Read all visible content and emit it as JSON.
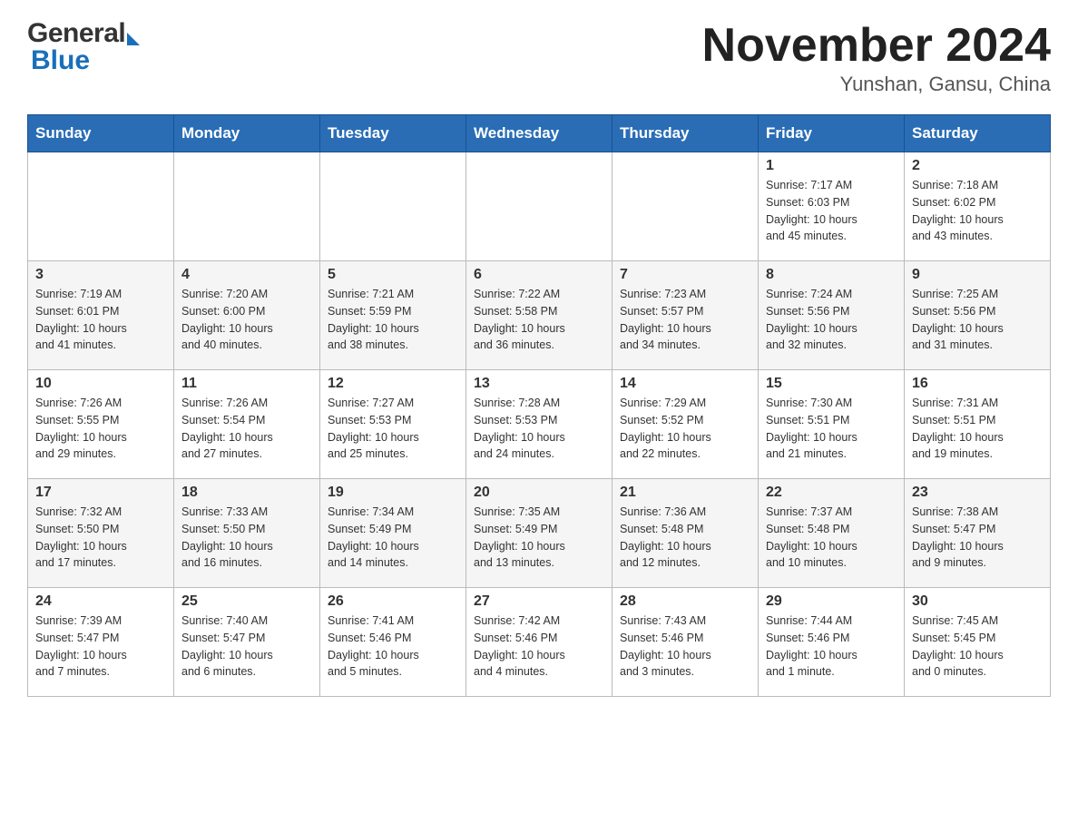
{
  "header": {
    "logo_general": "General",
    "logo_blue": "Blue",
    "month_year": "November 2024",
    "location": "Yunshan, Gansu, China"
  },
  "weekdays": [
    "Sunday",
    "Monday",
    "Tuesday",
    "Wednesday",
    "Thursday",
    "Friday",
    "Saturday"
  ],
  "weeks": [
    [
      {
        "day": "",
        "info": ""
      },
      {
        "day": "",
        "info": ""
      },
      {
        "day": "",
        "info": ""
      },
      {
        "day": "",
        "info": ""
      },
      {
        "day": "",
        "info": ""
      },
      {
        "day": "1",
        "info": "Sunrise: 7:17 AM\nSunset: 6:03 PM\nDaylight: 10 hours\nand 45 minutes."
      },
      {
        "day": "2",
        "info": "Sunrise: 7:18 AM\nSunset: 6:02 PM\nDaylight: 10 hours\nand 43 minutes."
      }
    ],
    [
      {
        "day": "3",
        "info": "Sunrise: 7:19 AM\nSunset: 6:01 PM\nDaylight: 10 hours\nand 41 minutes."
      },
      {
        "day": "4",
        "info": "Sunrise: 7:20 AM\nSunset: 6:00 PM\nDaylight: 10 hours\nand 40 minutes."
      },
      {
        "day": "5",
        "info": "Sunrise: 7:21 AM\nSunset: 5:59 PM\nDaylight: 10 hours\nand 38 minutes."
      },
      {
        "day": "6",
        "info": "Sunrise: 7:22 AM\nSunset: 5:58 PM\nDaylight: 10 hours\nand 36 minutes."
      },
      {
        "day": "7",
        "info": "Sunrise: 7:23 AM\nSunset: 5:57 PM\nDaylight: 10 hours\nand 34 minutes."
      },
      {
        "day": "8",
        "info": "Sunrise: 7:24 AM\nSunset: 5:56 PM\nDaylight: 10 hours\nand 32 minutes."
      },
      {
        "day": "9",
        "info": "Sunrise: 7:25 AM\nSunset: 5:56 PM\nDaylight: 10 hours\nand 31 minutes."
      }
    ],
    [
      {
        "day": "10",
        "info": "Sunrise: 7:26 AM\nSunset: 5:55 PM\nDaylight: 10 hours\nand 29 minutes."
      },
      {
        "day": "11",
        "info": "Sunrise: 7:26 AM\nSunset: 5:54 PM\nDaylight: 10 hours\nand 27 minutes."
      },
      {
        "day": "12",
        "info": "Sunrise: 7:27 AM\nSunset: 5:53 PM\nDaylight: 10 hours\nand 25 minutes."
      },
      {
        "day": "13",
        "info": "Sunrise: 7:28 AM\nSunset: 5:53 PM\nDaylight: 10 hours\nand 24 minutes."
      },
      {
        "day": "14",
        "info": "Sunrise: 7:29 AM\nSunset: 5:52 PM\nDaylight: 10 hours\nand 22 minutes."
      },
      {
        "day": "15",
        "info": "Sunrise: 7:30 AM\nSunset: 5:51 PM\nDaylight: 10 hours\nand 21 minutes."
      },
      {
        "day": "16",
        "info": "Sunrise: 7:31 AM\nSunset: 5:51 PM\nDaylight: 10 hours\nand 19 minutes."
      }
    ],
    [
      {
        "day": "17",
        "info": "Sunrise: 7:32 AM\nSunset: 5:50 PM\nDaylight: 10 hours\nand 17 minutes."
      },
      {
        "day": "18",
        "info": "Sunrise: 7:33 AM\nSunset: 5:50 PM\nDaylight: 10 hours\nand 16 minutes."
      },
      {
        "day": "19",
        "info": "Sunrise: 7:34 AM\nSunset: 5:49 PM\nDaylight: 10 hours\nand 14 minutes."
      },
      {
        "day": "20",
        "info": "Sunrise: 7:35 AM\nSunset: 5:49 PM\nDaylight: 10 hours\nand 13 minutes."
      },
      {
        "day": "21",
        "info": "Sunrise: 7:36 AM\nSunset: 5:48 PM\nDaylight: 10 hours\nand 12 minutes."
      },
      {
        "day": "22",
        "info": "Sunrise: 7:37 AM\nSunset: 5:48 PM\nDaylight: 10 hours\nand 10 minutes."
      },
      {
        "day": "23",
        "info": "Sunrise: 7:38 AM\nSunset: 5:47 PM\nDaylight: 10 hours\nand 9 minutes."
      }
    ],
    [
      {
        "day": "24",
        "info": "Sunrise: 7:39 AM\nSunset: 5:47 PM\nDaylight: 10 hours\nand 7 minutes."
      },
      {
        "day": "25",
        "info": "Sunrise: 7:40 AM\nSunset: 5:47 PM\nDaylight: 10 hours\nand 6 minutes."
      },
      {
        "day": "26",
        "info": "Sunrise: 7:41 AM\nSunset: 5:46 PM\nDaylight: 10 hours\nand 5 minutes."
      },
      {
        "day": "27",
        "info": "Sunrise: 7:42 AM\nSunset: 5:46 PM\nDaylight: 10 hours\nand 4 minutes."
      },
      {
        "day": "28",
        "info": "Sunrise: 7:43 AM\nSunset: 5:46 PM\nDaylight: 10 hours\nand 3 minutes."
      },
      {
        "day": "29",
        "info": "Sunrise: 7:44 AM\nSunset: 5:46 PM\nDaylight: 10 hours\nand 1 minute."
      },
      {
        "day": "30",
        "info": "Sunrise: 7:45 AM\nSunset: 5:45 PM\nDaylight: 10 hours\nand 0 minutes."
      }
    ]
  ]
}
